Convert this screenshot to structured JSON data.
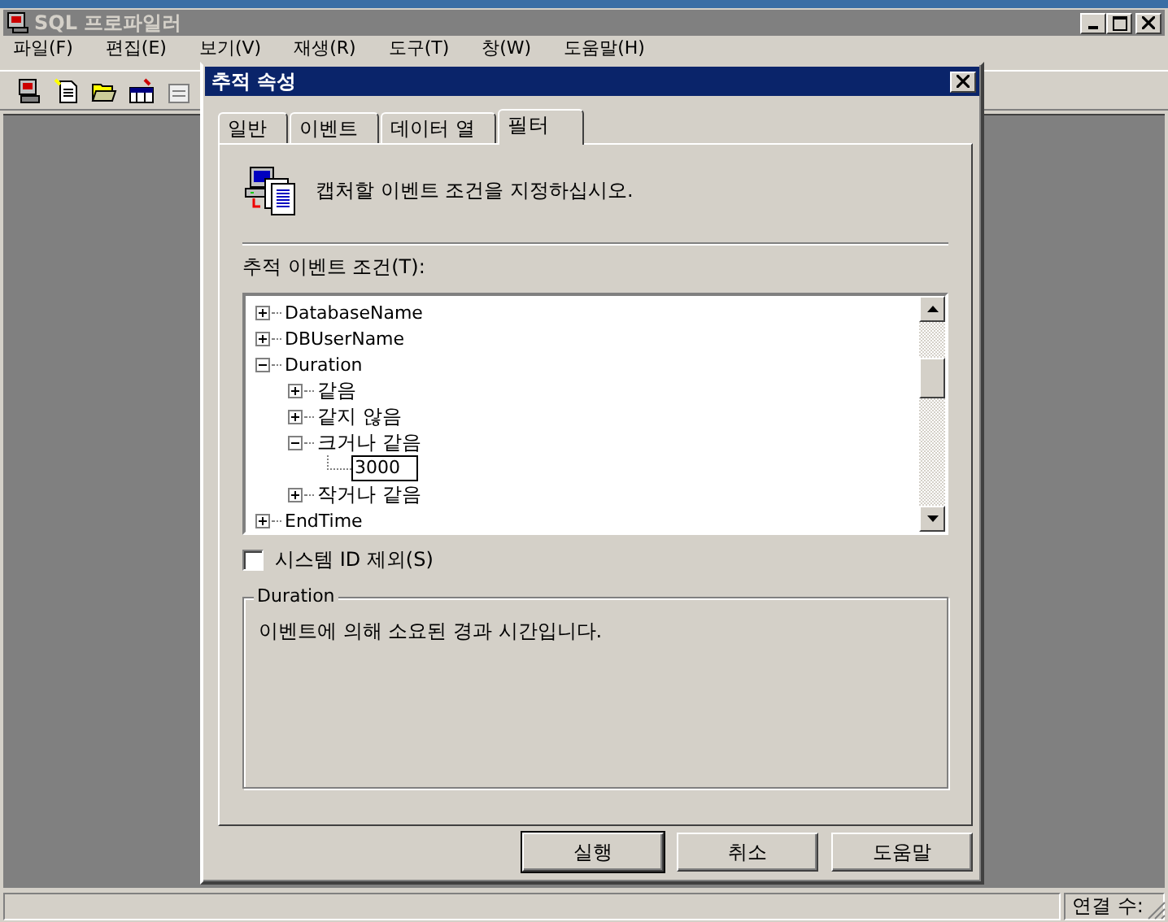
{
  "window": {
    "title": "SQL 프로파일러",
    "active": false
  },
  "menu": [
    "파일(F)",
    "편집(E)",
    "보기(V)",
    "재생(R)",
    "도구(T)",
    "창(W)",
    "도움말(H)"
  ],
  "dialog": {
    "title": "추적 속성",
    "tabs": [
      {
        "label": "일반",
        "selected": false
      },
      {
        "label": "이벤트",
        "selected": false
      },
      {
        "label": "데이터 열",
        "selected": false
      },
      {
        "label": "필터",
        "selected": true
      }
    ],
    "intro": "캡처할 이벤트 조건을 지정하십시오.",
    "tree_label": "추적 이벤트 조건(T):",
    "tree": [
      {
        "label": "DatabaseName",
        "expanded": false
      },
      {
        "label": "DBUserName",
        "expanded": false
      },
      {
        "label": "Duration",
        "expanded": true,
        "children": [
          {
            "label": "같음",
            "expanded": false
          },
          {
            "label": "같지 않음",
            "expanded": false
          },
          {
            "label": "크거나 같음",
            "expanded": true,
            "children": [
              {
                "kind": "edit",
                "value": "3000"
              }
            ]
          },
          {
            "label": "작거나 같음",
            "expanded": false
          }
        ]
      },
      {
        "label": "EndTime",
        "expanded": false
      }
    ],
    "checkbox": {
      "label": "시스템 ID 제외(S)",
      "checked": false
    },
    "group": {
      "title": "Duration",
      "text": "이벤트에 의해 소요된 경과 시간입니다."
    },
    "buttons": [
      {
        "label": "실행",
        "default": true
      },
      {
        "label": "취소",
        "default": false
      },
      {
        "label": "도움말",
        "default": false
      }
    ]
  },
  "status_bar": {
    "connections": "연결 수:"
  }
}
